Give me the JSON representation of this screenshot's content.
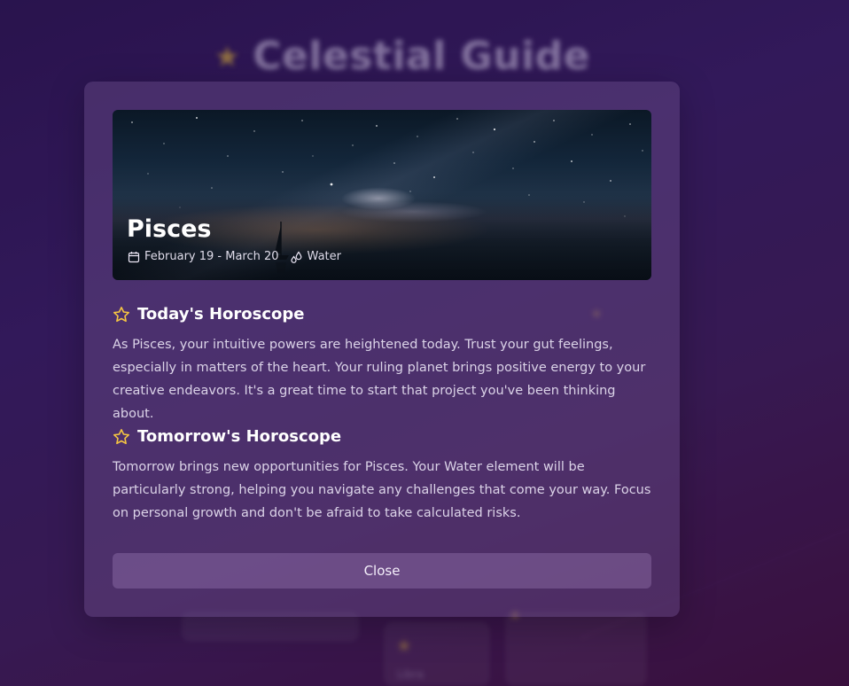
{
  "background": {
    "app_title": "Celestial Guide",
    "card_label": "Libra"
  },
  "modal": {
    "sign_name": "Pisces",
    "date_range": "February 19 - March 20",
    "element": "Water",
    "today": {
      "heading": "Today's Horoscope",
      "text": "As Pisces, your intuitive powers are heightened today. Trust your gut feelings, especially in matters of the heart. Your ruling planet brings positive energy to your creative endeavors. It's a great time to start that project you've been thinking about."
    },
    "tomorrow": {
      "heading": "Tomorrow's Horoscope",
      "text": "Tomorrow brings new opportunities for Pisces. Your Water element will be particularly strong, helping you navigate any challenges that come your way. Focus on personal growth and don't be afraid to take calculated risks."
    },
    "close_label": "Close"
  },
  "icons": {
    "header_star": "star-icon",
    "date": "calendar-icon",
    "element": "water-drops-icon",
    "section_star": "star-outline-icon"
  },
  "colors": {
    "accent_star": "#f5c542",
    "background_top": "#2a1450",
    "background_bottom": "#3d0f3c"
  }
}
